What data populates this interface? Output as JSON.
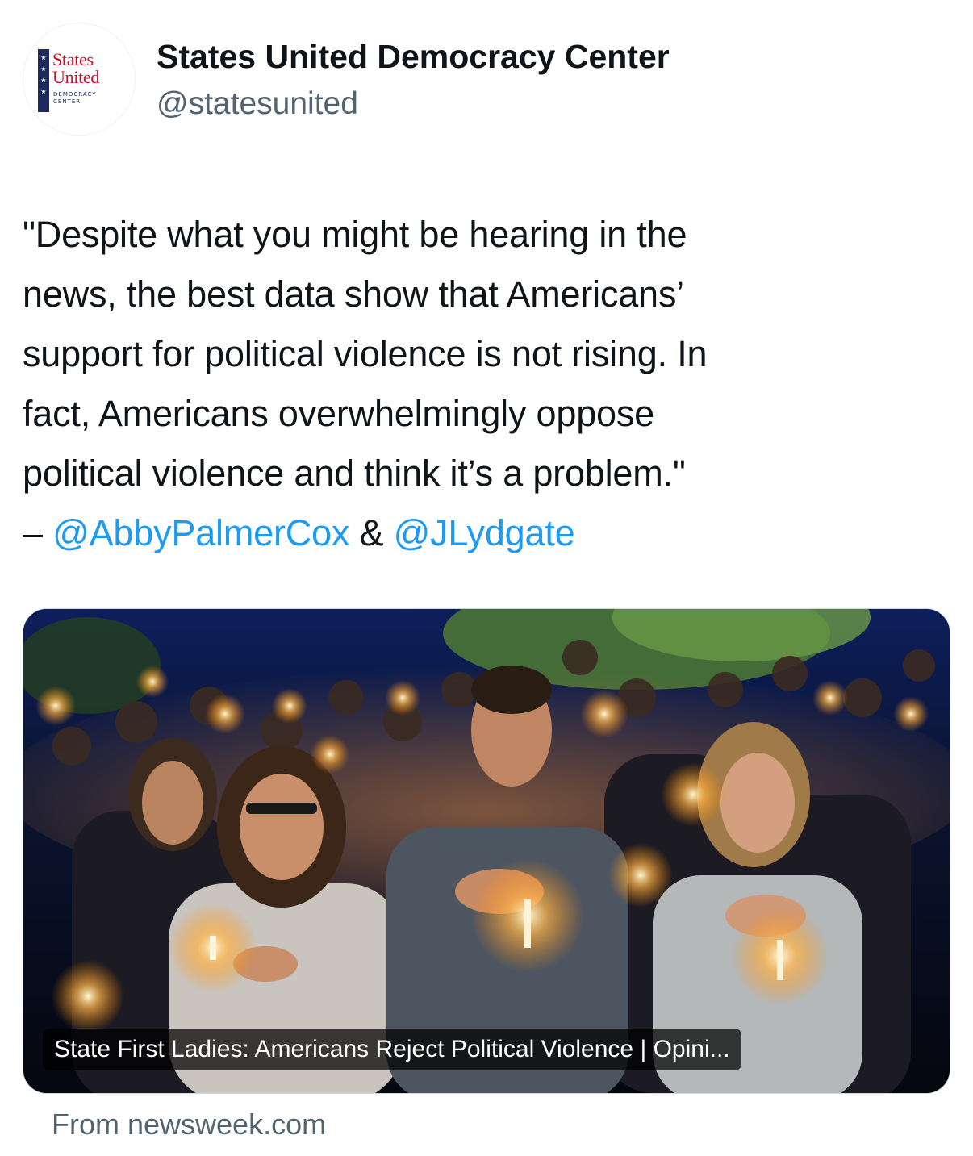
{
  "account": {
    "display_name": "States United Democracy Center",
    "handle": "@statesunited",
    "avatar_logo": {
      "word1": "States",
      "word2": "United",
      "line1": "DEMOCRACY",
      "line2": "CENTER",
      "star": "★"
    }
  },
  "tweet": {
    "lines": [
      "\"Despite what you might be hearing in the",
      "news, the best data show that Americans’",
      "support for political violence is not rising. In",
      "fact, Americans overwhelmingly oppose",
      "political violence and think it’s a problem.\""
    ],
    "attribution_prefix": "– ",
    "mention_1": "@AbbyPalmerCox",
    "joiner": " & ",
    "mention_2": "@JLydgate"
  },
  "card": {
    "title": "State First Ladies: Americans Reject Political Violence | Opini...",
    "image_description_icon": "photo-icon"
  },
  "source": {
    "text": "From newsweek.com"
  },
  "colors": {
    "text_primary": "#0f1419",
    "text_secondary": "#536471",
    "link": "#1d9bf0",
    "logo_red": "#c8102e",
    "logo_navy": "#1e2a5a"
  }
}
